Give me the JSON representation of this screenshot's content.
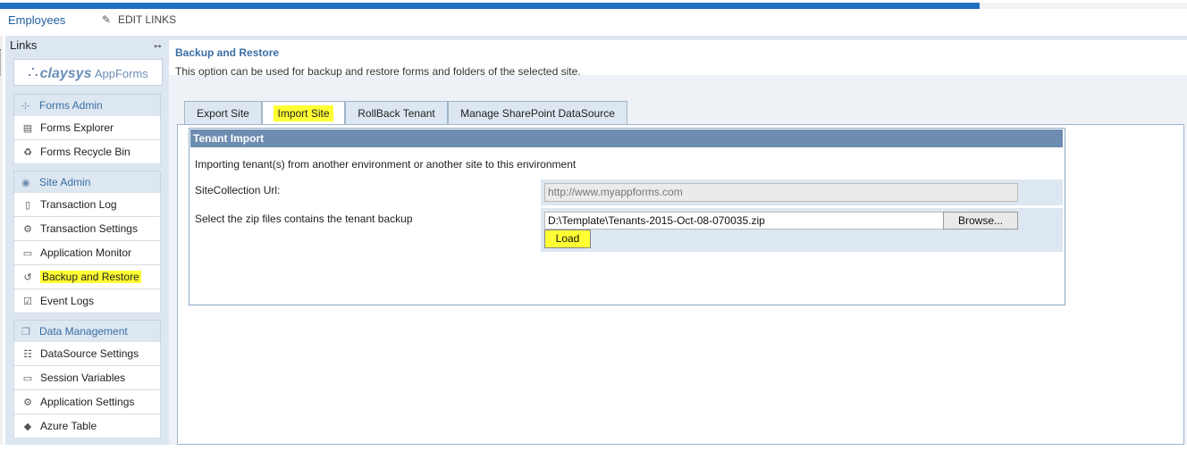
{
  "topbar": {
    "progress": 0.825,
    "nav_employees": "Employees",
    "nav_edit_links": "EDIT LINKS",
    "colors": {
      "progress": "#1f6fbf",
      "link": "#1f5fa0"
    }
  },
  "sidebar": {
    "title": "Links",
    "toggle_icon": "↔",
    "logo": {
      "mark": "∴",
      "brand": "claysys",
      "sub": "AppForms"
    },
    "sections": [
      {
        "header": "Forms Admin",
        "icon": "sitemap-icon",
        "items": [
          {
            "label": "Forms Explorer",
            "icon": "forms-explorer-icon"
          },
          {
            "label": "Forms Recycle Bin",
            "icon": "recycle-bin-icon"
          }
        ]
      },
      {
        "header": "Site Admin",
        "icon": "globe-icon",
        "items": [
          {
            "label": "Transaction Log",
            "icon": "document-icon"
          },
          {
            "label": "Transaction Settings",
            "icon": "settings-document-icon"
          },
          {
            "label": "Application Monitor",
            "icon": "monitor-icon"
          },
          {
            "label": "Backup and Restore",
            "icon": "history-icon",
            "highlighted": true
          },
          {
            "label": "Event Logs",
            "icon": "checklist-icon"
          }
        ]
      },
      {
        "header": "Data Management",
        "icon": "copy-icon",
        "items": [
          {
            "label": "DataSource Settings",
            "icon": "datasource-icon"
          },
          {
            "label": "Session Variables",
            "icon": "variables-icon"
          },
          {
            "label": "Application Settings",
            "icon": "app-settings-icon"
          },
          {
            "label": "Azure Table",
            "icon": "tag-icon"
          }
        ]
      }
    ]
  },
  "main": {
    "title": "Backup and Restore",
    "description": "This option can be used for backup and restore forms and folders of the selected site.",
    "tabs": [
      {
        "label": "Export Site",
        "active": false
      },
      {
        "label": "Import Site",
        "active": true,
        "highlighted": true
      },
      {
        "label": "RollBack Tenant",
        "active": false
      },
      {
        "label": "Manage SharePoint DataSource",
        "active": false
      }
    ],
    "tenant_import": {
      "title": "Tenant Import",
      "description": "Importing tenant(s) from another environment or another site to this environment",
      "url_label": "SiteCollection Url:",
      "url_value": "http://www.myappforms.com",
      "zip_label": "Select the zip files contains the tenant backup",
      "file_value": "D:\\Template\\Tenants-2015-Oct-08-070035.zip",
      "browse_label": "Browse...",
      "load_label": "Load"
    },
    "colors": {
      "highlight": "#ffff33",
      "fieldset_header": "#6d8db0",
      "accent": "#3a6ea5"
    }
  }
}
